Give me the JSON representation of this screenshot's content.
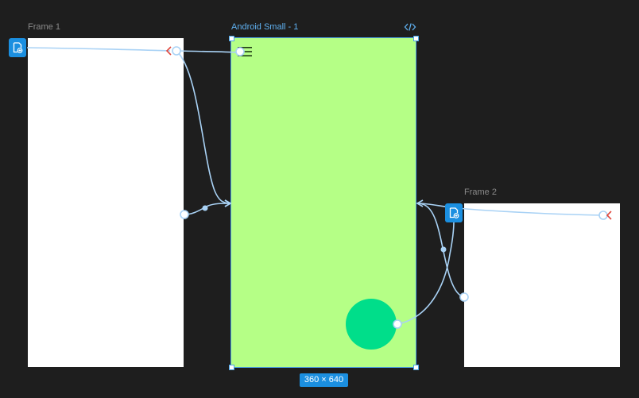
{
  "canvas": {
    "background": "#1e1e1e",
    "frames": [
      {
        "id": "frame-1",
        "label": "Frame 1",
        "fill": "#ffffff"
      },
      {
        "id": "android-small-1",
        "label": "Android Small - 1",
        "fill": "#b5ff86",
        "selected": true
      },
      {
        "id": "frame-2",
        "label": "Frame 2",
        "fill": "#ffffff"
      }
    ],
    "selection": {
      "size_label": "360 × 640",
      "accent": "#1b8fe0",
      "outline": "#4aa3e6"
    },
    "android_frame": {
      "menu_icon": "hamburger-menu-icon",
      "fab_color": "#00de8a"
    },
    "icons": {
      "start_badge": "flow-start-icon",
      "code": "code-icon",
      "back_arrow": "back-arrow-icon"
    },
    "prototype_link_color": "#a9d2f5"
  }
}
